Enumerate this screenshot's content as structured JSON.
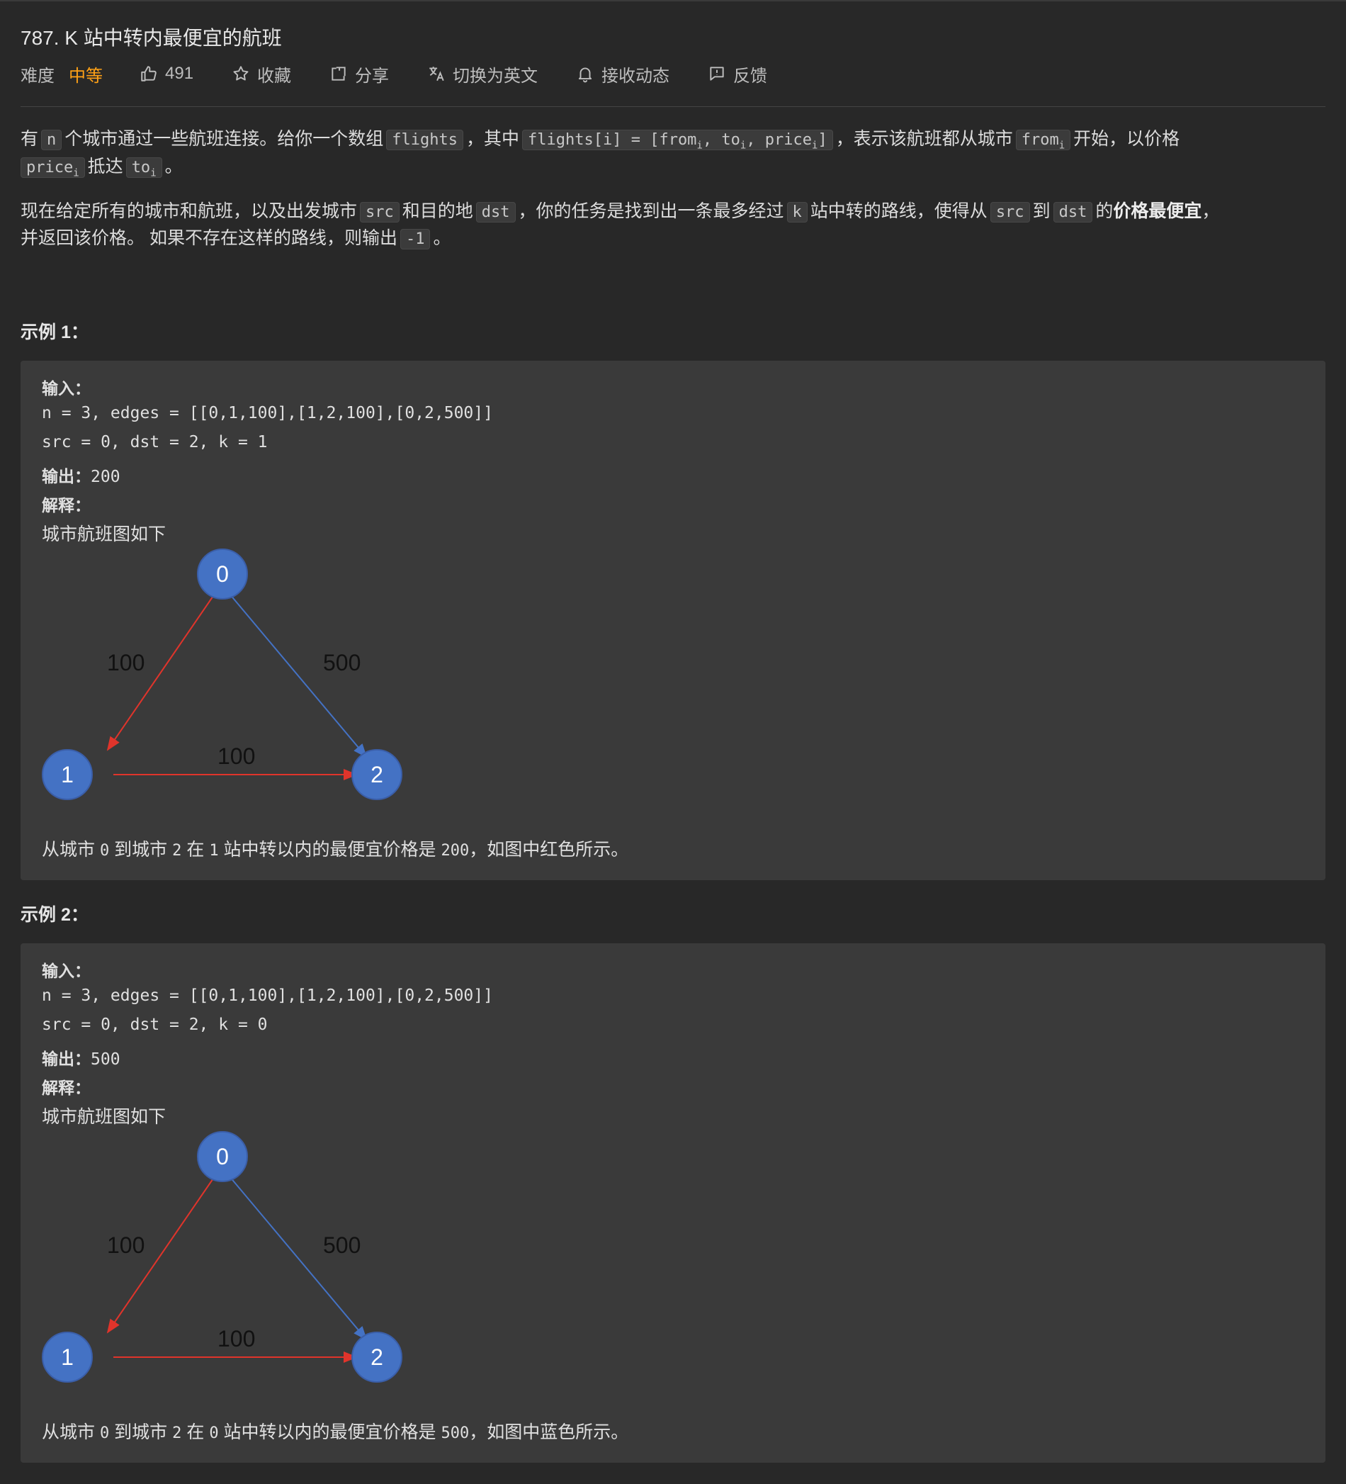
{
  "header": {
    "title": "787. K 站中转内最便宜的航班",
    "difficulty_label": "难度",
    "difficulty_value": "中等",
    "likes": "491",
    "favorite": "收藏",
    "share": "分享",
    "switch_lang": "切换为英文",
    "subscribe": "接收动态",
    "feedback": "反馈"
  },
  "colors": {
    "difficulty": "#ffa116",
    "node": "#4472c4",
    "edge_red": "#e0342b",
    "edge_blue": "#4472c4"
  },
  "description": {
    "p1": {
      "t1": "有",
      "c1": "n",
      "t2": "个城市通过一些航班连接。给你一个数组",
      "c2": "flights",
      "t3": "，其中",
      "c3a": "flights[i] = [from",
      "c3s1": "i",
      "c3b": ", to",
      "c3s2": "i",
      "c3c": ", price",
      "c3s3": "i",
      "c3d": "]",
      "t4": "，表示该航班都从城市",
      "c4": "from",
      "c4s": "i",
      "t5": "开始，以价格",
      "c5": "price",
      "c5s": "i",
      "t6": "抵达",
      "c6": "to",
      "c6s": "i",
      "t7": "。"
    },
    "p2": {
      "t1": "现在给定所有的城市和航班，以及出发城市",
      "c1": "src",
      "t2": "和目的地",
      "c2": "dst",
      "t3": "，你的任务是找到出一条最多经过",
      "c3": "k",
      "t4": "站中转的路线，使得从",
      "c4": "src",
      "t5": "到",
      "c5": "dst",
      "t6": "的",
      "b1": "价格最便宜",
      "t7": "，",
      "t8": "并返回该价格。 如果不存在这样的路线，则输出",
      "c6": "-1",
      "t9": "。"
    }
  },
  "examples": [
    {
      "title": "示例 1：",
      "input_label": "输入：",
      "input_line1": "n = 3, edges = [[0,1,100],[1,2,100],[0,2,500]]",
      "input_line2": "src = 0, dst = 2, k = 1",
      "output_label": "输出：",
      "output_value": "200",
      "explain_label": "解释：",
      "graph_caption": "城市航班图如下",
      "nodes": [
        "0",
        "1",
        "2"
      ],
      "edge_labels": [
        "100",
        "500",
        "100"
      ],
      "result": {
        "t1": "从城市",
        "m1": "0",
        "t2": "到城市",
        "m2": "2",
        "t3": "在",
        "m3": "1",
        "t4": "站中转以内的最便宜价格是",
        "m4": "200",
        "t5": "，如图中红色所示。"
      }
    },
    {
      "title": "示例 2：",
      "input_label": "输入：",
      "input_line1": "n = 3, edges = [[0,1,100],[1,2,100],[0,2,500]]",
      "input_line2": "src = 0, dst = 2, k = 0",
      "output_label": "输出：",
      "output_value": "500",
      "explain_label": "解释：",
      "graph_caption": "城市航班图如下",
      "nodes": [
        "0",
        "1",
        "2"
      ],
      "edge_labels": [
        "100",
        "500",
        "100"
      ],
      "result": {
        "t1": "从城市",
        "m1": "0",
        "t2": "到城市",
        "m2": "2",
        "t3": "在",
        "m3": "0",
        "t4": "站中转以内的最便宜价格是",
        "m4": "500",
        "t5": "，如图中蓝色所示。"
      }
    }
  ]
}
